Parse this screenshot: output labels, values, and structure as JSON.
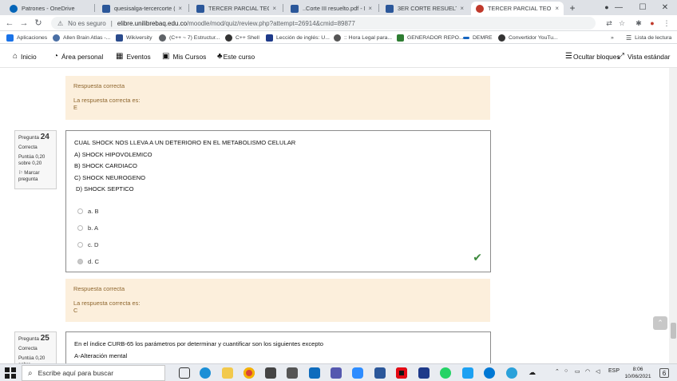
{
  "browser": {
    "tabs": [
      {
        "title": "Patrones - OneDrive",
        "icon": "onedrive-icon",
        "color": "#0364b8",
        "active": false
      },
      {
        "title": "quesisalga-tercercorte (1).pd",
        "icon": "word-icon",
        "color": "#2b579a",
        "active": false
      },
      {
        "title": "TERCER PARCIAL TEÓRICO",
        "icon": "word-icon",
        "color": "#2b579a",
        "active": false
      },
      {
        "title": "..Corte III resuelto.pdf - Mic",
        "icon": "word-icon",
        "color": "#2b579a",
        "active": false
      },
      {
        "title": "3ER CORTE RESUELTOU.pdf",
        "icon": "word-icon",
        "color": "#2b579a",
        "active": false
      },
      {
        "title": "TERCER PARCIAL TEORICO",
        "icon": "moodle-icon",
        "color": "#c0392b",
        "active": true
      }
    ],
    "tab_close": "×",
    "new_tab": "+",
    "window_controls": {
      "minimize": "—",
      "maximize": "☐",
      "close": "✕"
    },
    "address": {
      "security": "No es seguro",
      "host": "elibre.unilibrebaq.edu.co",
      "path": "/moodle/mod/quiz/review.php?attempt=26914&cmid=89877"
    },
    "bookmarks": [
      {
        "label": "Aplicaciones",
        "color": "#1a73e8"
      },
      {
        "label": "Allen Brain Atlas -...",
        "color": "#4a6fa5"
      },
      {
        "label": "Wikiversity",
        "color": "#2a4b8d"
      },
      {
        "label": "(C++ ~ 7) Estructur...",
        "color": "#5f6368"
      },
      {
        "label": "C++ Shell",
        "color": "#333333"
      },
      {
        "label": "Lección de inglés: U...",
        "color": "#1e3a8a"
      },
      {
        "label": ":: Hora Legal para...",
        "color": "#555555"
      },
      {
        "label": "GENERADOR REPO...",
        "color": "#2e7d32"
      },
      {
        "label": "DEMRE",
        "color": "#1565c0"
      },
      {
        "label": "Convertidor YouTu...",
        "color": "#333333"
      }
    ],
    "bookmarks_more": "»",
    "reading_list": "Lista de lectura"
  },
  "moodle_nav": {
    "home": "Inicio",
    "personal": "Área personal",
    "events": "Eventos",
    "courses": "Mis Cursos",
    "this_course": "Este curso",
    "hide_blocks": "Ocultar bloques",
    "standard_view": "Vista estándar"
  },
  "feedback_top": {
    "title": "Respuesta correcta",
    "line1": "La respuesta correcta es:",
    "line2": "E"
  },
  "question24": {
    "label": "Pregunta",
    "number": "24",
    "state": "Correcta",
    "grade": "Puntúa 0,20 sobre 0,20",
    "flag": "Marcar pregunta",
    "text_lines": [
      "CUAL SHOCK NOS LLEVA A UN DETERIORO EN EL METABOLISMO CELULAR",
      "A) SHOCK HIPOVOLEMICO",
      "B)  SHOCK CARDIACO",
      "C)  SHOCK NEUROGENO",
      "D)  SHOCK SEPTICO"
    ],
    "options": [
      {
        "label": "a. B",
        "selected": false
      },
      {
        "label": "b. A",
        "selected": false
      },
      {
        "label": "c. D",
        "selected": false
      },
      {
        "label": "d. C",
        "selected": true
      }
    ],
    "feedback": {
      "title": "Respuesta correcta",
      "line1": "La respuesta correcta es:",
      "line2": "C"
    }
  },
  "question25": {
    "label": "Pregunta",
    "number": "25",
    "state": "Correcta",
    "grade": "Puntúa 0,20 sobre",
    "text_lines": [
      "En el índice CURB-65 los parámetros por determinar y cuantificar son los siguientes excepto",
      "A-Alteración mental"
    ]
  },
  "taskbar": {
    "search_placeholder": "Escribe aquí para buscar",
    "language": "ESP",
    "time": "8:06",
    "date": "10/06/2021",
    "notifications": "6"
  }
}
